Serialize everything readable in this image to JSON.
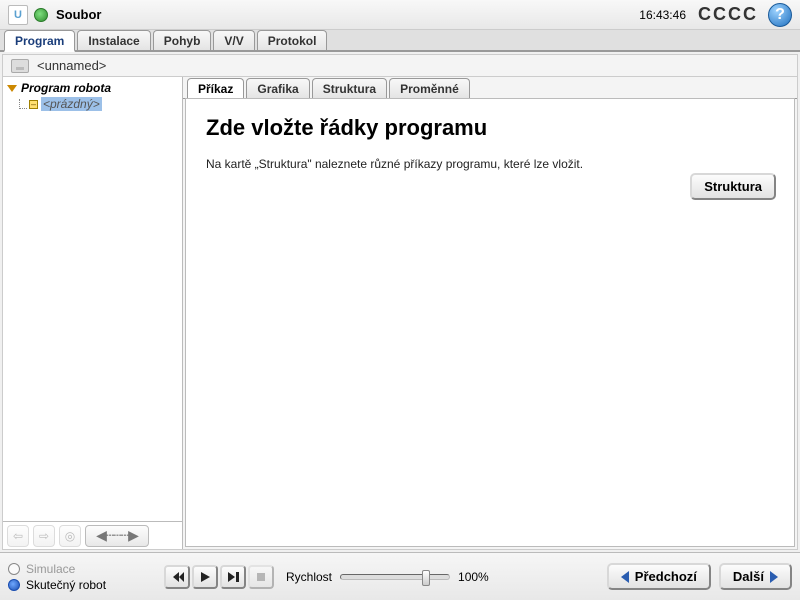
{
  "titlebar": {
    "logo_text": "U",
    "file_menu": "Soubor",
    "time": "16:43:46",
    "cccc": "CCCC",
    "help_glyph": "?"
  },
  "main_tabs": [
    "Program",
    "Instalace",
    "Pohyb",
    "V/V",
    "Protokol"
  ],
  "main_tab_active": 0,
  "subbar": {
    "filename": "<unnamed>"
  },
  "tree": {
    "root": "Program robota",
    "empty": "<prázdný>",
    "minus_glyph": "–"
  },
  "tree_toolbar": {
    "back": "⇦",
    "fwd": "⇨",
    "target": "◎",
    "slider": "◀┄┄┄▶"
  },
  "sub_tabs": [
    "Příkaz",
    "Grafika",
    "Struktura",
    "Proměnné"
  ],
  "sub_tab_active": 0,
  "content": {
    "heading": "Zde vložte řádky programu",
    "para": "Na kartě „Struktura\" naleznete různé příkazy programu, které lze vložit.",
    "structure_btn": "Struktura"
  },
  "footer": {
    "sim_label": "Simulace",
    "real_label": "Skutečný robot",
    "speed_label": "Rychlost",
    "speed_value": "100%",
    "slider_pct": 75,
    "prev_btn": "Předchozí",
    "next_btn": "Další"
  }
}
